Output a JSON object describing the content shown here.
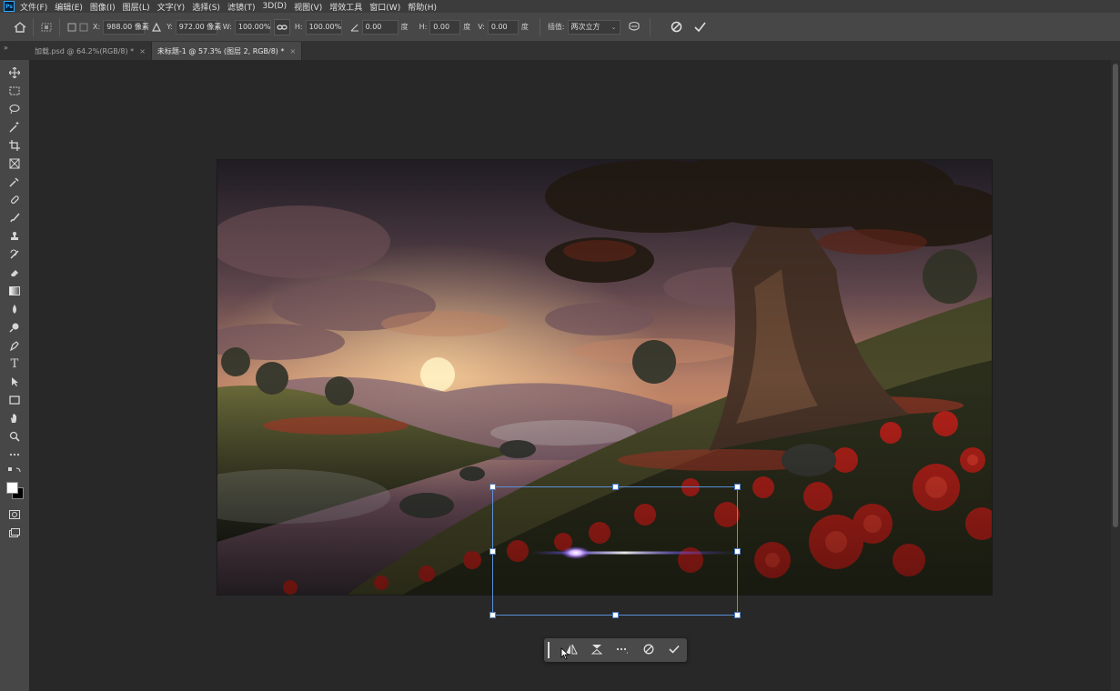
{
  "menubar": {
    "app_icon": "Ps",
    "items": [
      "文件(F)",
      "编辑(E)",
      "图像(I)",
      "图层(L)",
      "文字(Y)",
      "选择(S)",
      "滤镜(T)",
      "3D(D)",
      "视图(V)",
      "增效工具",
      "窗口(W)",
      "帮助(H)"
    ]
  },
  "options": {
    "x_label": "X:",
    "x_value": "988.00 像素",
    "y_label": "Y:",
    "y_value": "972.00 像素",
    "w_label": "W:",
    "w_value": "100.00%",
    "h_label": "H:",
    "h_value": "100.00%",
    "angle_value": "0.00",
    "angle_unit": "度",
    "hskew_label": "H:",
    "hskew_value": "0.00",
    "hskew_unit": "度",
    "vskew_label": "V:",
    "vskew_value": "0.00",
    "vskew_unit": "度",
    "interp_label": "插值:",
    "interp_value": "两次立方"
  },
  "tabs": [
    {
      "label": "加载.psd @ 64.2%(RGB/8) *",
      "close": "×"
    },
    {
      "label": "未标题-1 @ 57.3% (图层 2, RGB/8) *",
      "close": "×"
    }
  ],
  "tabstrip_left": "»",
  "tools": [
    "move-tool-icon",
    "marquee-tool-icon",
    "lasso-tool-icon",
    "magic-wand-icon",
    "crop-tool-icon",
    "frame-tool-icon",
    "eyedropper-icon",
    "healing-brush-icon",
    "brush-tool-icon",
    "stamp-tool-icon",
    "history-brush-icon",
    "eraser-icon",
    "gradient-icon",
    "blur-icon",
    "dodge-icon",
    "pen-tool-icon",
    "type-tool-icon",
    "path-select-icon",
    "rectangle-tool-icon",
    "hand-tool-icon",
    "zoom-tool-icon",
    "more-tools-icon"
  ],
  "colors": {
    "foreground": "#ffffff",
    "background": "#000000",
    "accent": "#5a8fd6"
  }
}
